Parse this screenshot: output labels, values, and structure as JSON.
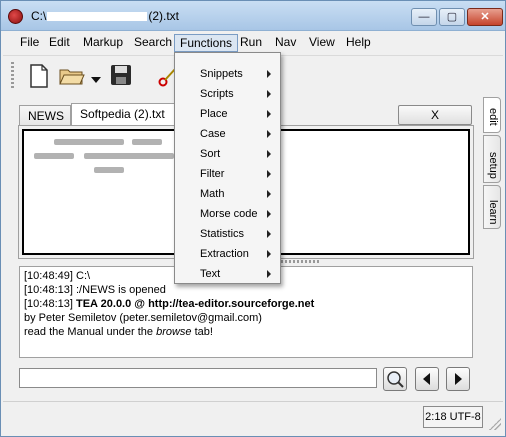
{
  "window": {
    "title_prefix": "C:\\",
    "title_suffix": "(2).txt",
    "minimize": "—",
    "maximize": "▢",
    "close": "✕"
  },
  "menubar": {
    "items": [
      "File",
      "Edit",
      "Markup",
      "Search",
      "Functions",
      "Run",
      "Nav",
      "View",
      "Help"
    ],
    "active": "Functions"
  },
  "toolbar": {
    "icons": [
      "new-file-icon",
      "open-folder-icon",
      "save-disk-icon",
      "cut-scissors-icon"
    ]
  },
  "tabs": {
    "items": [
      "NEWS",
      "Softpedia (2).txt"
    ],
    "selected": "Softpedia (2).txt",
    "close_button": "X"
  },
  "side_tabs": [
    "edit",
    "setup",
    "learn"
  ],
  "functions_menu": {
    "items": [
      "Snippets",
      "Scripts",
      "Place",
      "Case",
      "Sort",
      "Filter",
      "Math",
      "Morse code",
      "Statistics",
      "Extraction",
      "Text"
    ]
  },
  "log": {
    "lines": [
      {
        "time": "[10:48:49]",
        "text": "C:\\"
      },
      {
        "time": "[10:48:13]",
        "text": ":/NEWS is opened"
      },
      {
        "time": "[10:48:13]",
        "text": "TEA 20.0.0 @ http://tea-editor.sourceforge.net"
      },
      {
        "time": "",
        "text": "by Peter Semiletov (peter.semiletov@gmail.com)"
      }
    ],
    "manual_pre": "read the Manual under the ",
    "manual_em": "browse",
    "manual_post": " tab!"
  },
  "search": {
    "value": ""
  },
  "status": {
    "position": "2:18 UTF-8"
  },
  "colors": {
    "title_gradient_top": "#c9def3",
    "title_gradient_bottom": "#a8c6e6",
    "close_red": "#c5442c",
    "active_menu": "#dbe6f2"
  }
}
